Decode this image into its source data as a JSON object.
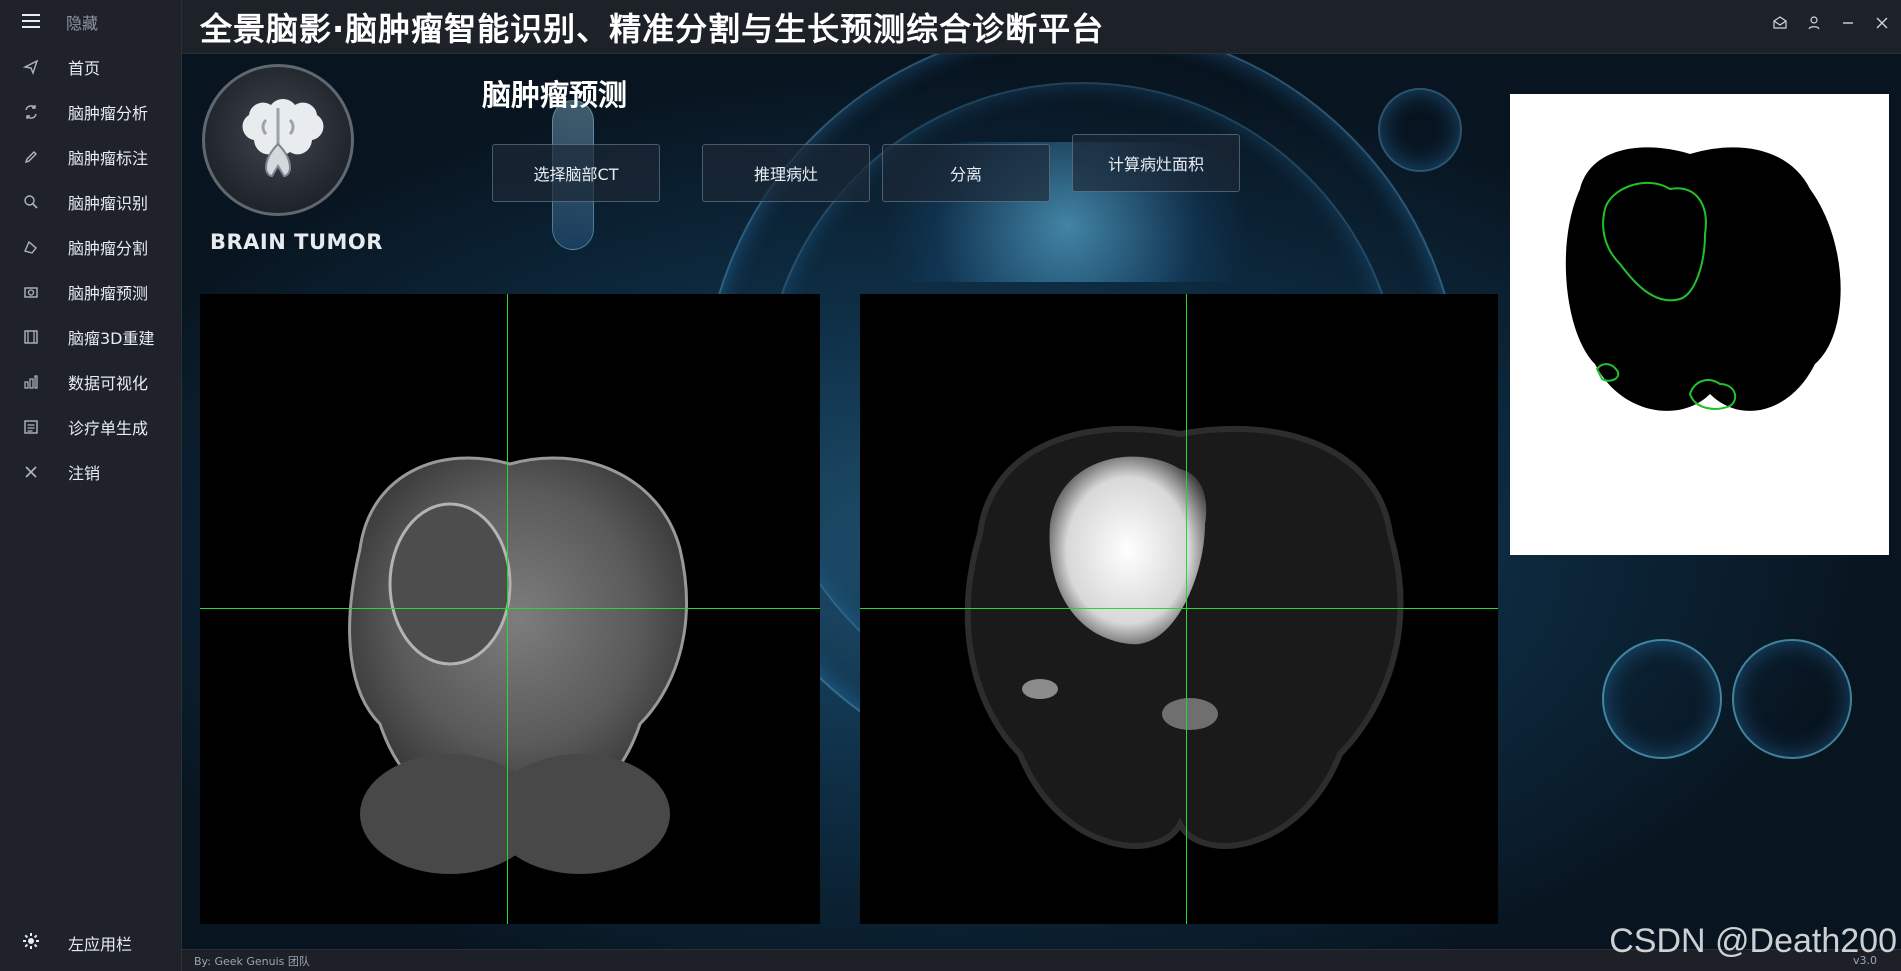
{
  "sidebar": {
    "toggle_label": "隐藏",
    "items": [
      {
        "label": "首页",
        "icon": "send-icon"
      },
      {
        "label": "脑肿瘤分析",
        "icon": "refresh-icon"
      },
      {
        "label": "脑肿瘤标注",
        "icon": "pencil-icon"
      },
      {
        "label": "脑肿瘤识别",
        "icon": "search-icon"
      },
      {
        "label": "脑肿瘤分割",
        "icon": "shape-icon"
      },
      {
        "label": "脑肿瘤预测",
        "icon": "camera-icon"
      },
      {
        "label": "脑瘤3D重建",
        "icon": "film-icon"
      },
      {
        "label": "数据可视化",
        "icon": "bar-chart-icon"
      },
      {
        "label": "诊疗单生成",
        "icon": "document-icon"
      },
      {
        "label": "注销",
        "icon": "close-icon"
      }
    ],
    "bottom_label": "左应用栏"
  },
  "header": {
    "title": "全景脑影·脑肿瘤智能识别、精准分割与生长预测综合诊断平台"
  },
  "main": {
    "logo_text": "BRAIN TUMOR",
    "section_title": "脑肿瘤预测",
    "buttons": {
      "select_ct": "选择脑部CT",
      "infer": "推理病灶",
      "separate": "分离",
      "area": "计算病灶面积"
    }
  },
  "footer": {
    "credit": "By: Geek Genuis 团队",
    "version": "v3.0"
  },
  "watermark": "CSDN @Death200"
}
